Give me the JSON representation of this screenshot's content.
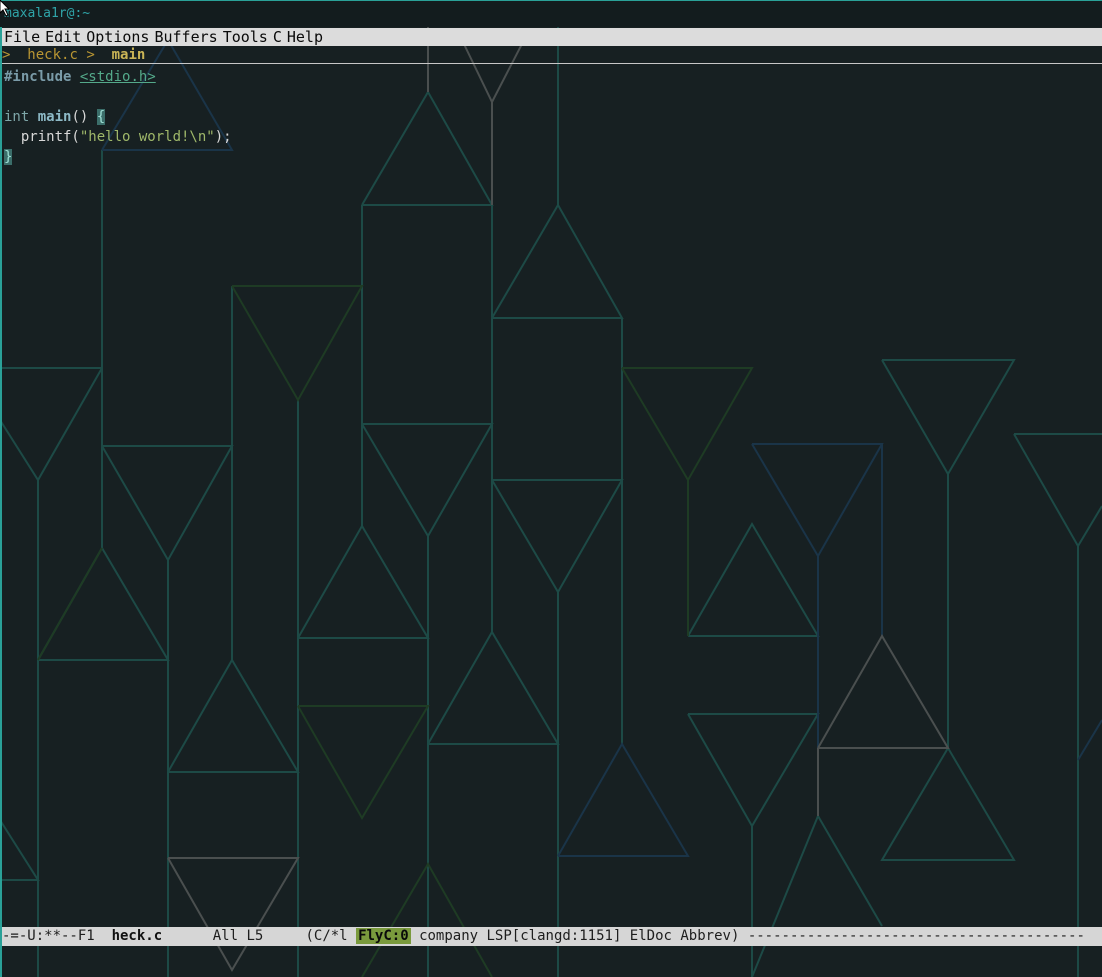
{
  "window": {
    "title": "maxala1r@:~"
  },
  "menubar": {
    "items": [
      "File",
      "Edit",
      "Options",
      "Buffers",
      "Tools",
      "C",
      "Help"
    ]
  },
  "headerline": {
    "sep1": ">",
    "file": "heck.c",
    "sep2": ">",
    "func": "main"
  },
  "code": {
    "line1_directive": "#include",
    "line1_header": "<stdio.h>",
    "line3_type": "int",
    "line3_func": "main",
    "line3_parens": "()",
    "line3_brace": "{",
    "line4_call": "  printf(",
    "line4_string": "\"hello world!\\n\"",
    "line4_end": ");",
    "line5_brace": "}"
  },
  "modeline": {
    "status": "-=-U:**--F1",
    "buffer": "heck.c",
    "position": "All L5",
    "mode_start": "(C/*l",
    "flycheck": "FlyC:0",
    "minor_modes": "company LSP[clangd:1151] ElDoc Abbrev)",
    "fill": "----------------------------------------"
  },
  "colors": {
    "accent": "#2aa198",
    "background": "#172022",
    "flycheck_ok": "#7a9a3d"
  }
}
